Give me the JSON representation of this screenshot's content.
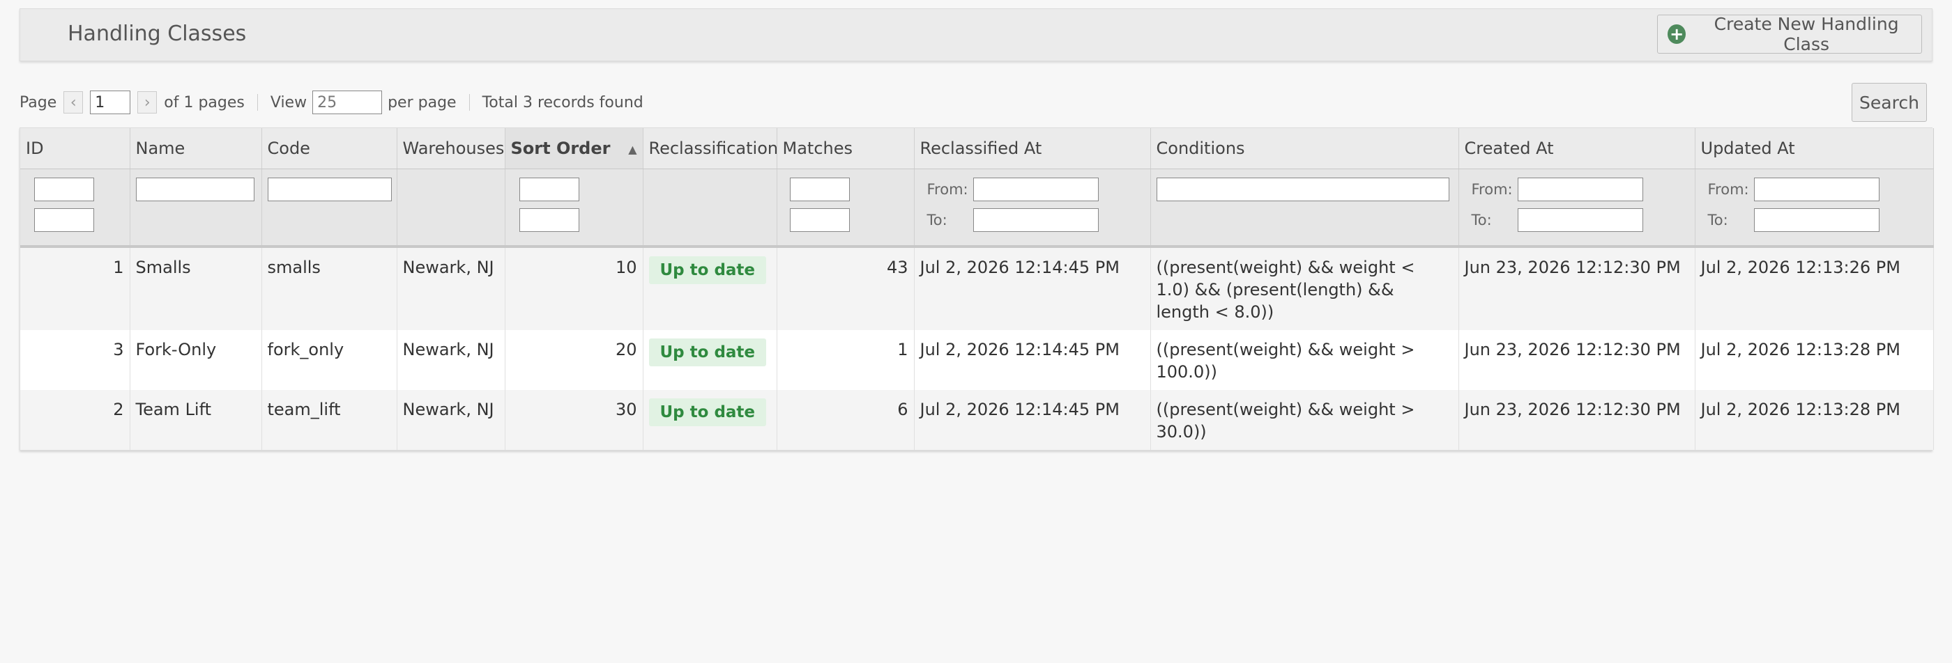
{
  "header": {
    "title": "Handling Classes",
    "create_label": "Create New Handling Class"
  },
  "pager": {
    "page_label": "Page",
    "current_page": "1",
    "of_pages": "of 1 pages",
    "view_label": "View",
    "per_page_value": "25",
    "per_page_label": "per page",
    "total": "Total 3 records found",
    "search_label": "Search"
  },
  "filters": {
    "from_label": "From:",
    "to_label": "To:"
  },
  "columns": [
    "ID",
    "Name",
    "Code",
    "Warehouses",
    "Sort Order",
    "Reclassification",
    "Matches",
    "Reclassified At",
    "Conditions",
    "Created At",
    "Updated At"
  ],
  "rows": [
    {
      "id": "1",
      "name": "Smalls",
      "code": "smalls",
      "warehouses": "Newark, NJ",
      "sort_order": "10",
      "reclassification": "Up to date",
      "matches": "43",
      "reclassified_at": "Jul 2, 2026 12:14:45 PM",
      "conditions": "((present(weight) && weight < 1.0) && (present(length) && length < 8.0))",
      "created_at": "Jun 23, 2026 12:12:30 PM",
      "updated_at": "Jul 2, 2026 12:13:26 PM"
    },
    {
      "id": "3",
      "name": "Fork-Only",
      "code": "fork_only",
      "warehouses": "Newark, NJ",
      "sort_order": "20",
      "reclassification": "Up to date",
      "matches": "1",
      "reclassified_at": "Jul 2, 2026 12:14:45 PM",
      "conditions": "((present(weight) && weight > 100.0))",
      "created_at": "Jun 23, 2026 12:12:30 PM",
      "updated_at": "Jul 2, 2026 12:13:28 PM"
    },
    {
      "id": "2",
      "name": "Team Lift",
      "code": "team_lift",
      "warehouses": "Newark, NJ",
      "sort_order": "30",
      "reclassification": "Up to date",
      "matches": "6",
      "reclassified_at": "Jul 2, 2026 12:14:45 PM",
      "conditions": "((present(weight) && weight > 30.0))",
      "created_at": "Jun 23, 2026 12:12:30 PM",
      "updated_at": "Jul 2, 2026 12:13:28 PM"
    }
  ],
  "colors": {
    "badge_bg": "#e1f2e3",
    "badge_text": "#2f8a3f",
    "create_icon": "#4e8a5c"
  },
  "icons": {
    "create": "plus-circle-icon",
    "prev": "chevron-left-icon",
    "next": "chevron-right-icon",
    "sort": "sort-ascending-icon"
  }
}
